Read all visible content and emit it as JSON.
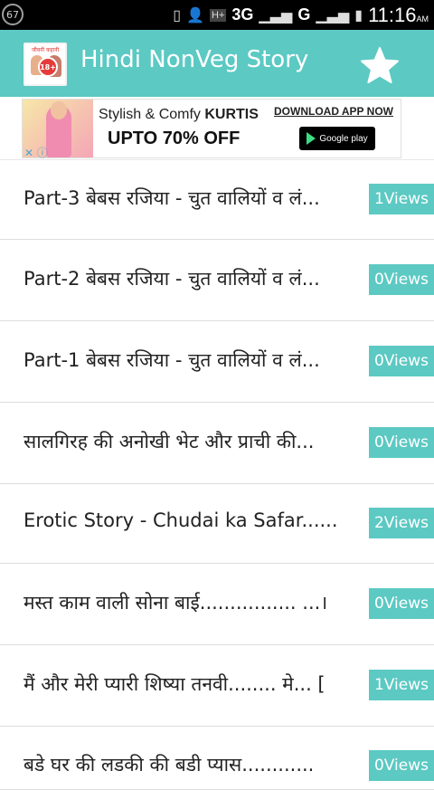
{
  "status_bar": {
    "notification_count": "67",
    "network": "3G",
    "network2": "G",
    "time": "11:16",
    "ampm": "AM"
  },
  "app_bar": {
    "title": "Hindi NonVeg Story",
    "logo_text": "जीवनी कहानी",
    "logo_mark": "18+",
    "star_color": "#ffffff",
    "accent_color": "#5cc9c3"
  },
  "ad": {
    "line1_plain": "Stylish & Comfy ",
    "line1_bold": "KURTIS",
    "line2": "UPTO 70% OFF",
    "cta": "DOWNLOAD APP NOW",
    "store": "Google play"
  },
  "stories": [
    {
      "title": "Part-3 बेबस रजिया - चुत वालियों व लं...",
      "views": "1Views"
    },
    {
      "title": "Part-2 बेबस रजिया - चुत वालियों व लं...",
      "views": "0Views"
    },
    {
      "title": "Part-1 बेबस रजिया - चुत वालियों व लं...",
      "views": "0Views"
    },
    {
      "title": "सालगिरह की अनोखी भेट और प्राची की...",
      "views": "0Views"
    },
    {
      "title": "Erotic Story - Chudai ka Safar......",
      "views": "2Views"
    },
    {
      "title": "मस्त काम वाली सोना बाई................ ...।",
      "views": "0Views"
    },
    {
      "title": "मैं और मेरी प्यारी शिष्या तनवी........ मे... [",
      "views": "1Views"
    },
    {
      "title": "बडे घर की लडकी की बडी प्यास............",
      "views": "0Views"
    }
  ]
}
